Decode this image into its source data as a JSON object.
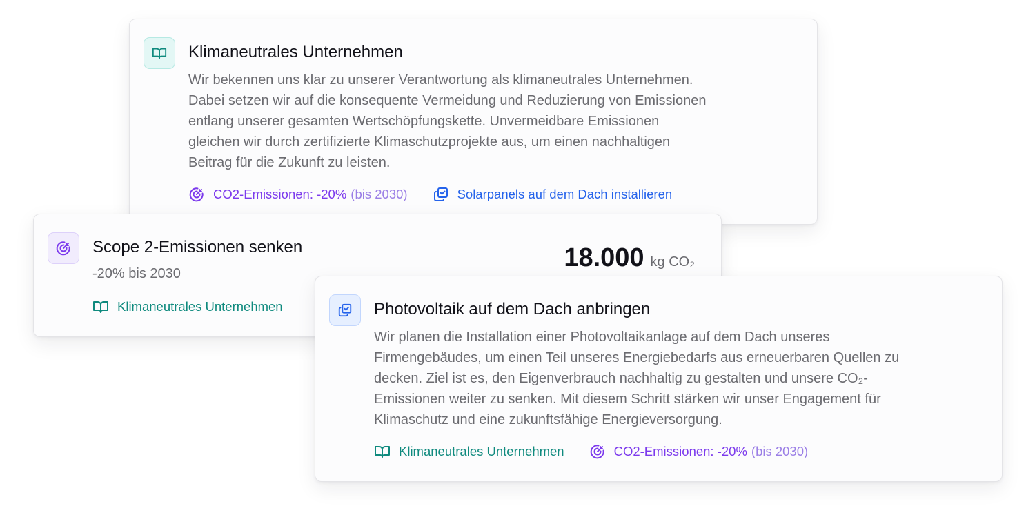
{
  "card1": {
    "icon": "book-icon",
    "title": "Klimaneutrales Unternehmen",
    "description_lines": [
      "Wir bekennen uns klar zu unserer Verantwortung als klimaneutrales Unternehmen.",
      "Dabei setzen wir auf die konsequente Vermeidung und Reduzierung von Emissionen",
      "entlang unserer gesamten Wertschöpfungskette. Unvermeidbare Emissionen",
      "gleichen wir durch zertifizierte Klimaschutzprojekte aus, um einen nachhaltigen",
      "Beitrag für die Zukunft zu leisten."
    ],
    "links": {
      "goal_label": "CO2-Emissionen: -20%",
      "goal_suffix": "(bis 2030)",
      "measure_label": "Solarpanels auf dem Dach installieren"
    }
  },
  "card2": {
    "icon": "target-icon",
    "title": "Scope 2-Emissionen senken",
    "subtitle": "-20% bis 2030",
    "metric_value": "18.000",
    "metric_unit": "kg CO₂",
    "link_label": "Klimaneutrales Unternehmen"
  },
  "card3": {
    "icon": "checklist-icon",
    "title": "Photovoltaik auf dem Dach anbringen",
    "description_lines": [
      "Wir planen die Installation einer Photovoltaikanlage auf dem Dach unseres",
      "Firmengebäudes, um einen Teil unseres Energiebedarfs aus erneuerbaren Quellen zu",
      "decken. Ziel ist es, den Eigenverbrauch nachhaltig zu gestalten und unsere CO₂-",
      "Emissionen weiter zu senken. Mit diesem Schritt stärken wir unser Engagement für",
      "Klimaschutz und eine zukunftsfähige Energieversorgung."
    ],
    "links": {
      "strategy_label": "Klimaneutrales Unternehmen",
      "goal_label": "CO2-Emissionen: -20%",
      "goal_suffix": "(bis 2030)"
    }
  },
  "colors": {
    "teal": "#0f8a7e",
    "purple": "#7c3aed",
    "blue": "#2563eb",
    "text": "#111118",
    "muted": "#6b6b70"
  }
}
